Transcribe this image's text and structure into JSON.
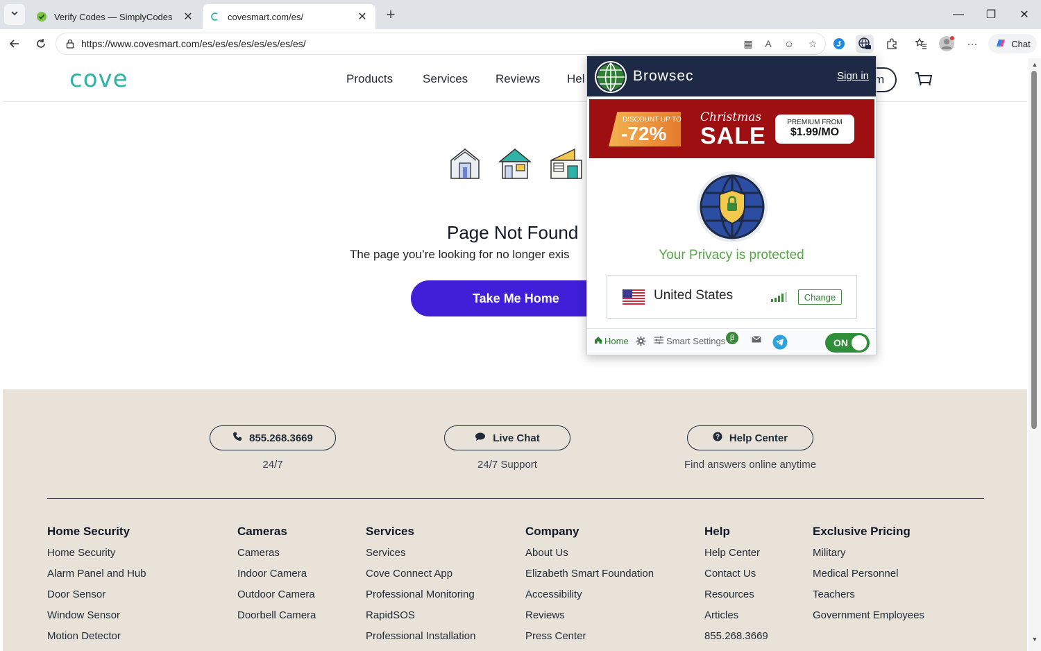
{
  "browser": {
    "tabs": [
      {
        "title": "Verify Codes — SimplyCodes",
        "active": false
      },
      {
        "title": "covesmart.com/es/",
        "active": true
      }
    ],
    "url": "https://www.covesmart.com/es/es/es/es/es/es/es/es/",
    "chat_label": "Chat"
  },
  "site": {
    "logo": "cove",
    "nav": [
      "Products",
      "Services",
      "Reviews",
      "Hel"
    ],
    "account_partial": "m",
    "error": {
      "title": "Page Not Found",
      "subtitle": "The page you’re looking for no longer exis",
      "button": "Take Me Home"
    },
    "contact": [
      {
        "label": "855.268.3669",
        "sub": "24/7",
        "icon": "phone-icon"
      },
      {
        "label": "Live Chat",
        "sub": "24/7 Support",
        "icon": "chat-bubble-icon"
      },
      {
        "label": "Help Center",
        "sub": "Find answers online anytime",
        "icon": "question-icon"
      }
    ],
    "footer_columns": [
      {
        "heading": "Home Security",
        "links": [
          "Home Security",
          "Alarm Panel and Hub",
          "Door Sensor",
          "Window Sensor",
          "Motion Detector"
        ]
      },
      {
        "heading": "Cameras",
        "links": [
          "Cameras",
          "Indoor Camera",
          "Outdoor Camera",
          "Doorbell Camera"
        ]
      },
      {
        "heading": "Services",
        "links": [
          "Services",
          "Cove Connect App",
          "Professional Monitoring",
          "RapidSOS",
          "Professional Installation"
        ]
      },
      {
        "heading": "Company",
        "links": [
          "About Us",
          "Elizabeth Smart Foundation",
          "Accessibility",
          "Reviews",
          "Press Center"
        ]
      },
      {
        "heading": "Help",
        "links": [
          "Help Center",
          "Contact Us",
          "Resources",
          "Articles",
          "855.268.3669"
        ]
      },
      {
        "heading": "Exclusive Pricing",
        "links": [
          "Military",
          "Medical Personnel",
          "Teachers",
          "Government Employees"
        ]
      }
    ],
    "colors": {
      "brand_teal": "#2fb3a6",
      "button_purple": "#3f1fd7",
      "footer_bg": "#e8e2d8"
    }
  },
  "browsec": {
    "brand": "Browsec",
    "sign_in": "Sign in",
    "banner": {
      "discount_label": "DISCOUNT UP TO",
      "discount_value": "-72%",
      "christmas": "Christmas",
      "sale": "SALE",
      "price_label": "PREMIUM FROM",
      "price_value": "$1.99/MO"
    },
    "status": "Your Privacy is protected",
    "country": "United States",
    "change": "Change",
    "footer": {
      "home": "Home",
      "smart_settings": "Smart Settings",
      "beta": "β",
      "toggle": "ON"
    },
    "colors": {
      "header": "#1e2a45",
      "green": "#2f8f39",
      "banner_red": "#9e0f12"
    }
  }
}
